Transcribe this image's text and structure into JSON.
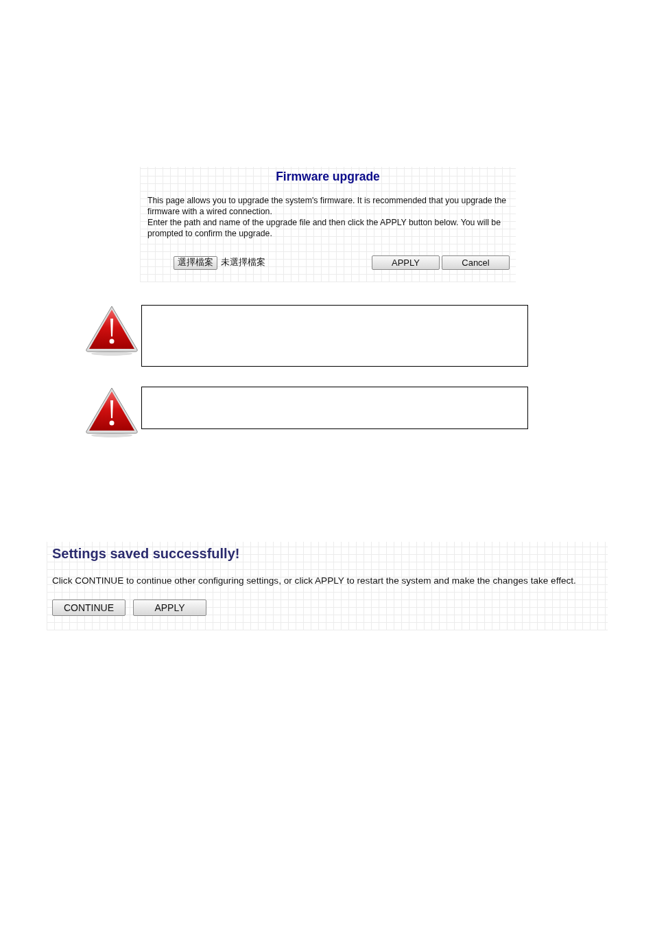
{
  "firmware_panel": {
    "title": "Firmware upgrade",
    "paragraphs": [
      "This page allows you to upgrade the system's firmware. It is recommended that you upgrade the firmware with a wired connection.",
      "Enter the path and name of the upgrade file and then click the APPLY button below. You will be prompted to confirm the upgrade."
    ],
    "file_button": "選擇檔案",
    "file_status": "未選擇檔案",
    "buttons": [
      "APPLY",
      "Cancel"
    ]
  },
  "warnings": [
    {
      "kind": "warning"
    },
    {
      "kind": "warning"
    }
  ],
  "settings_panel": {
    "title": "Settings saved successfully!",
    "message": "Click CONTINUE to continue other configuring settings, or click APPLY to restart the system and make the changes take effect.",
    "buttons": [
      "CONTINUE",
      "APPLY"
    ]
  }
}
